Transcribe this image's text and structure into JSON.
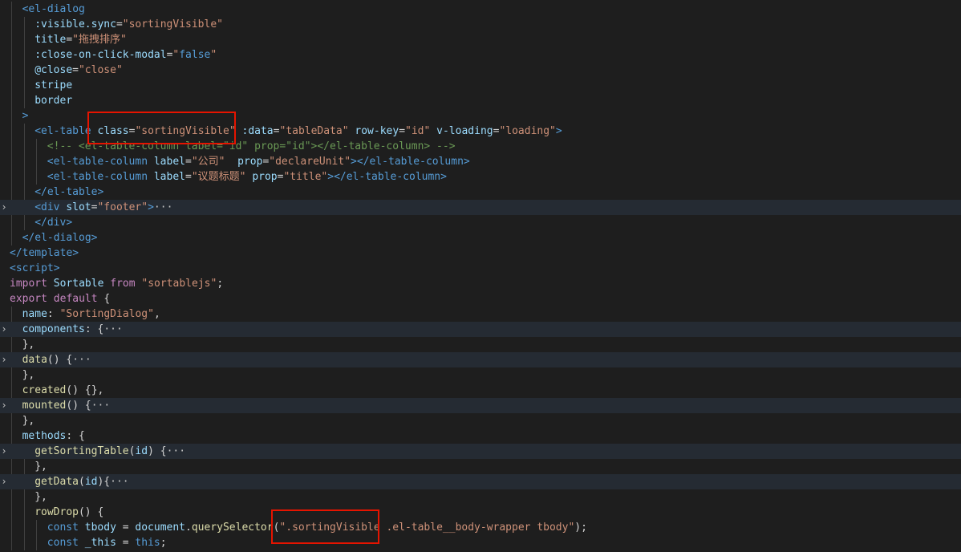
{
  "colors": {
    "background": "#1e1e1e",
    "tag": "#569cd6",
    "attribute": "#9cdcfe",
    "string": "#ce9178",
    "keyword": "#c586c0",
    "function": "#dcdcaa",
    "comment": "#6a9955",
    "text": "#d4d4d4",
    "highlight_box": "#e51400"
  },
  "icons": {
    "fold_collapsed": "chevron-right-icon"
  },
  "lines": [
    {
      "indent": 2,
      "fold": false,
      "tokens": [
        {
          "c": "t-tag",
          "t": "<el-dialog"
        }
      ]
    },
    {
      "indent": 4,
      "fold": false,
      "tokens": [
        {
          "c": "t-attr",
          "t": ":visible.sync"
        },
        {
          "c": "t-def",
          "t": "="
        },
        {
          "c": "t-str",
          "t": "\"sortingVisible\""
        }
      ]
    },
    {
      "indent": 4,
      "fold": false,
      "tokens": [
        {
          "c": "t-attr",
          "t": "title"
        },
        {
          "c": "t-def",
          "t": "="
        },
        {
          "c": "t-str",
          "t": "\"拖拽排序\""
        }
      ]
    },
    {
      "indent": 4,
      "fold": false,
      "tokens": [
        {
          "c": "t-attr",
          "t": ":close-on-click-modal"
        },
        {
          "c": "t-def",
          "t": "="
        },
        {
          "c": "t-str",
          "t": "\""
        },
        {
          "c": "t-tag",
          "t": "false"
        },
        {
          "c": "t-str",
          "t": "\""
        }
      ]
    },
    {
      "indent": 4,
      "fold": false,
      "tokens": [
        {
          "c": "t-attr",
          "t": "@close"
        },
        {
          "c": "t-def",
          "t": "="
        },
        {
          "c": "t-str",
          "t": "\"close\""
        }
      ]
    },
    {
      "indent": 4,
      "fold": false,
      "tokens": [
        {
          "c": "t-attr",
          "t": "stripe"
        }
      ]
    },
    {
      "indent": 4,
      "fold": false,
      "tokens": [
        {
          "c": "t-attr",
          "t": "border"
        }
      ]
    },
    {
      "indent": 2,
      "fold": false,
      "tokens": [
        {
          "c": "t-tag",
          "t": ">"
        }
      ]
    },
    {
      "indent": 4,
      "fold": false,
      "tokens": [
        {
          "c": "t-tag",
          "t": "<el-table"
        },
        {
          "c": "t-def",
          "t": " "
        },
        {
          "c": "t-attr",
          "t": "class"
        },
        {
          "c": "t-def",
          "t": "="
        },
        {
          "c": "t-str",
          "t": "\"sortingVisible\""
        },
        {
          "c": "t-def",
          "t": " "
        },
        {
          "c": "t-attr",
          "t": ":data"
        },
        {
          "c": "t-def",
          "t": "="
        },
        {
          "c": "t-str",
          "t": "\"tableData\""
        },
        {
          "c": "t-def",
          "t": " "
        },
        {
          "c": "t-attr",
          "t": "row-key"
        },
        {
          "c": "t-def",
          "t": "="
        },
        {
          "c": "t-str",
          "t": "\"id\""
        },
        {
          "c": "t-def",
          "t": " "
        },
        {
          "c": "t-attr",
          "t": "v-loading"
        },
        {
          "c": "t-def",
          "t": "="
        },
        {
          "c": "t-str",
          "t": "\"loading\""
        },
        {
          "c": "t-tag",
          "t": ">"
        }
      ]
    },
    {
      "indent": 6,
      "fold": false,
      "tokens": [
        {
          "c": "t-cm",
          "t": "<!-- <el-table-column label=\"id\" prop=\"id\"></el-table-column> -->"
        }
      ]
    },
    {
      "indent": 6,
      "fold": false,
      "tokens": [
        {
          "c": "t-tag",
          "t": "<el-table-column"
        },
        {
          "c": "t-def",
          "t": " "
        },
        {
          "c": "t-attr",
          "t": "label"
        },
        {
          "c": "t-def",
          "t": "="
        },
        {
          "c": "t-str",
          "t": "\"公司\""
        },
        {
          "c": "t-def",
          "t": "  "
        },
        {
          "c": "t-attr",
          "t": "prop"
        },
        {
          "c": "t-def",
          "t": "="
        },
        {
          "c": "t-str",
          "t": "\"declareUnit\""
        },
        {
          "c": "t-tag",
          "t": "></el-table-column>"
        }
      ]
    },
    {
      "indent": 6,
      "fold": false,
      "tokens": [
        {
          "c": "t-tag",
          "t": "<el-table-column"
        },
        {
          "c": "t-def",
          "t": " "
        },
        {
          "c": "t-attr",
          "t": "label"
        },
        {
          "c": "t-def",
          "t": "="
        },
        {
          "c": "t-str",
          "t": "\"议题标题\""
        },
        {
          "c": "t-def",
          "t": " "
        },
        {
          "c": "t-attr",
          "t": "prop"
        },
        {
          "c": "t-def",
          "t": "="
        },
        {
          "c": "t-str",
          "t": "\"title\""
        },
        {
          "c": "t-tag",
          "t": "></el-table-column>"
        }
      ]
    },
    {
      "indent": 4,
      "fold": false,
      "tokens": [
        {
          "c": "t-tag",
          "t": "</el-table>"
        }
      ]
    },
    {
      "indent": 4,
      "fold": true,
      "tokens": [
        {
          "c": "t-tag",
          "t": "<div"
        },
        {
          "c": "t-def",
          "t": " "
        },
        {
          "c": "t-attr",
          "t": "slot"
        },
        {
          "c": "t-def",
          "t": "="
        },
        {
          "c": "t-str",
          "t": "\"footer\""
        },
        {
          "c": "t-tag",
          "t": ">"
        },
        {
          "c": "ellipsis",
          "t": "···"
        }
      ]
    },
    {
      "indent": 4,
      "fold": false,
      "tokens": [
        {
          "c": "t-tag",
          "t": "</div>"
        }
      ]
    },
    {
      "indent": 2,
      "fold": false,
      "tokens": [
        {
          "c": "t-tag",
          "t": "</el-dialog>"
        }
      ]
    },
    {
      "indent": 0,
      "fold": false,
      "tokens": [
        {
          "c": "t-tag",
          "t": "</template>"
        }
      ]
    },
    {
      "indent": 0,
      "fold": false,
      "tokens": [
        {
          "c": "t-tag",
          "t": "<script>"
        }
      ]
    },
    {
      "indent": 0,
      "fold": false,
      "tokens": [
        {
          "c": "t-key",
          "t": "import"
        },
        {
          "c": "t-def",
          "t": " "
        },
        {
          "c": "t-attr",
          "t": "Sortable"
        },
        {
          "c": "t-def",
          "t": " "
        },
        {
          "c": "t-key",
          "t": "from"
        },
        {
          "c": "t-def",
          "t": " "
        },
        {
          "c": "t-str",
          "t": "\"sortablejs\""
        },
        {
          "c": "t-def",
          "t": ";"
        }
      ]
    },
    {
      "indent": 0,
      "fold": false,
      "tokens": [
        {
          "c": "t-key",
          "t": "export"
        },
        {
          "c": "t-def",
          "t": " "
        },
        {
          "c": "t-key",
          "t": "default"
        },
        {
          "c": "t-def",
          "t": " {"
        }
      ]
    },
    {
      "indent": 2,
      "fold": false,
      "tokens": [
        {
          "c": "t-attr",
          "t": "name"
        },
        {
          "c": "t-def",
          "t": ": "
        },
        {
          "c": "t-str",
          "t": "\"SortingDialog\""
        },
        {
          "c": "t-def",
          "t": ","
        }
      ]
    },
    {
      "indent": 2,
      "fold": true,
      "tokens": [
        {
          "c": "t-attr",
          "t": "components"
        },
        {
          "c": "t-def",
          "t": ": {"
        },
        {
          "c": "ellipsis",
          "t": "···"
        }
      ]
    },
    {
      "indent": 2,
      "fold": false,
      "tokens": [
        {
          "c": "t-def",
          "t": "},"
        }
      ]
    },
    {
      "indent": 2,
      "fold": true,
      "tokens": [
        {
          "c": "t-fn",
          "t": "data"
        },
        {
          "c": "t-def",
          "t": "() {"
        },
        {
          "c": "ellipsis",
          "t": "···"
        }
      ]
    },
    {
      "indent": 2,
      "fold": false,
      "tokens": [
        {
          "c": "t-def",
          "t": "},"
        }
      ]
    },
    {
      "indent": 2,
      "fold": false,
      "tokens": [
        {
          "c": "t-fn",
          "t": "created"
        },
        {
          "c": "t-def",
          "t": "() {},"
        }
      ]
    },
    {
      "indent": 2,
      "fold": true,
      "tokens": [
        {
          "c": "t-fn",
          "t": "mounted"
        },
        {
          "c": "t-def",
          "t": "() {"
        },
        {
          "c": "ellipsis",
          "t": "···"
        }
      ]
    },
    {
      "indent": 2,
      "fold": false,
      "tokens": [
        {
          "c": "t-def",
          "t": "},"
        }
      ]
    },
    {
      "indent": 2,
      "fold": false,
      "tokens": [
        {
          "c": "t-attr",
          "t": "methods"
        },
        {
          "c": "t-def",
          "t": ": {"
        }
      ]
    },
    {
      "indent": 4,
      "fold": true,
      "tokens": [
        {
          "c": "t-fn",
          "t": "getSortingTable"
        },
        {
          "c": "t-def",
          "t": "("
        },
        {
          "c": "t-attr",
          "t": "id"
        },
        {
          "c": "t-def",
          "t": ") {"
        },
        {
          "c": "ellipsis",
          "t": "···"
        }
      ]
    },
    {
      "indent": 4,
      "fold": false,
      "tokens": [
        {
          "c": "t-def",
          "t": "},"
        }
      ]
    },
    {
      "indent": 4,
      "fold": true,
      "tokens": [
        {
          "c": "t-fn",
          "t": "getData"
        },
        {
          "c": "t-def",
          "t": "("
        },
        {
          "c": "t-attr",
          "t": "id"
        },
        {
          "c": "t-def",
          "t": "){"
        },
        {
          "c": "ellipsis",
          "t": "···"
        }
      ]
    },
    {
      "indent": 4,
      "fold": false,
      "tokens": [
        {
          "c": "t-def",
          "t": "},"
        }
      ]
    },
    {
      "indent": 4,
      "fold": false,
      "tokens": [
        {
          "c": "t-fn",
          "t": "rowDrop"
        },
        {
          "c": "t-def",
          "t": "() {"
        }
      ]
    },
    {
      "indent": 6,
      "fold": false,
      "tokens": [
        {
          "c": "t-tag",
          "t": "const"
        },
        {
          "c": "t-def",
          "t": " "
        },
        {
          "c": "t-attr",
          "t": "tbody"
        },
        {
          "c": "t-def",
          "t": " = "
        },
        {
          "c": "t-attr",
          "t": "document"
        },
        {
          "c": "t-def",
          "t": "."
        },
        {
          "c": "t-fn",
          "t": "querySelector"
        },
        {
          "c": "t-def",
          "t": "("
        },
        {
          "c": "t-str",
          "t": "\".sortingVisible .el-table__body-wrapper tbody\""
        },
        {
          "c": "t-def",
          "t": ");"
        }
      ]
    },
    {
      "indent": 6,
      "fold": false,
      "tokens": [
        {
          "c": "t-tag",
          "t": "const"
        },
        {
          "c": "t-def",
          "t": " "
        },
        {
          "c": "t-attr",
          "t": "_this"
        },
        {
          "c": "t-def",
          "t": " = "
        },
        {
          "c": "t-tag",
          "t": "this"
        },
        {
          "c": "t-def",
          "t": ";"
        }
      ]
    }
  ]
}
